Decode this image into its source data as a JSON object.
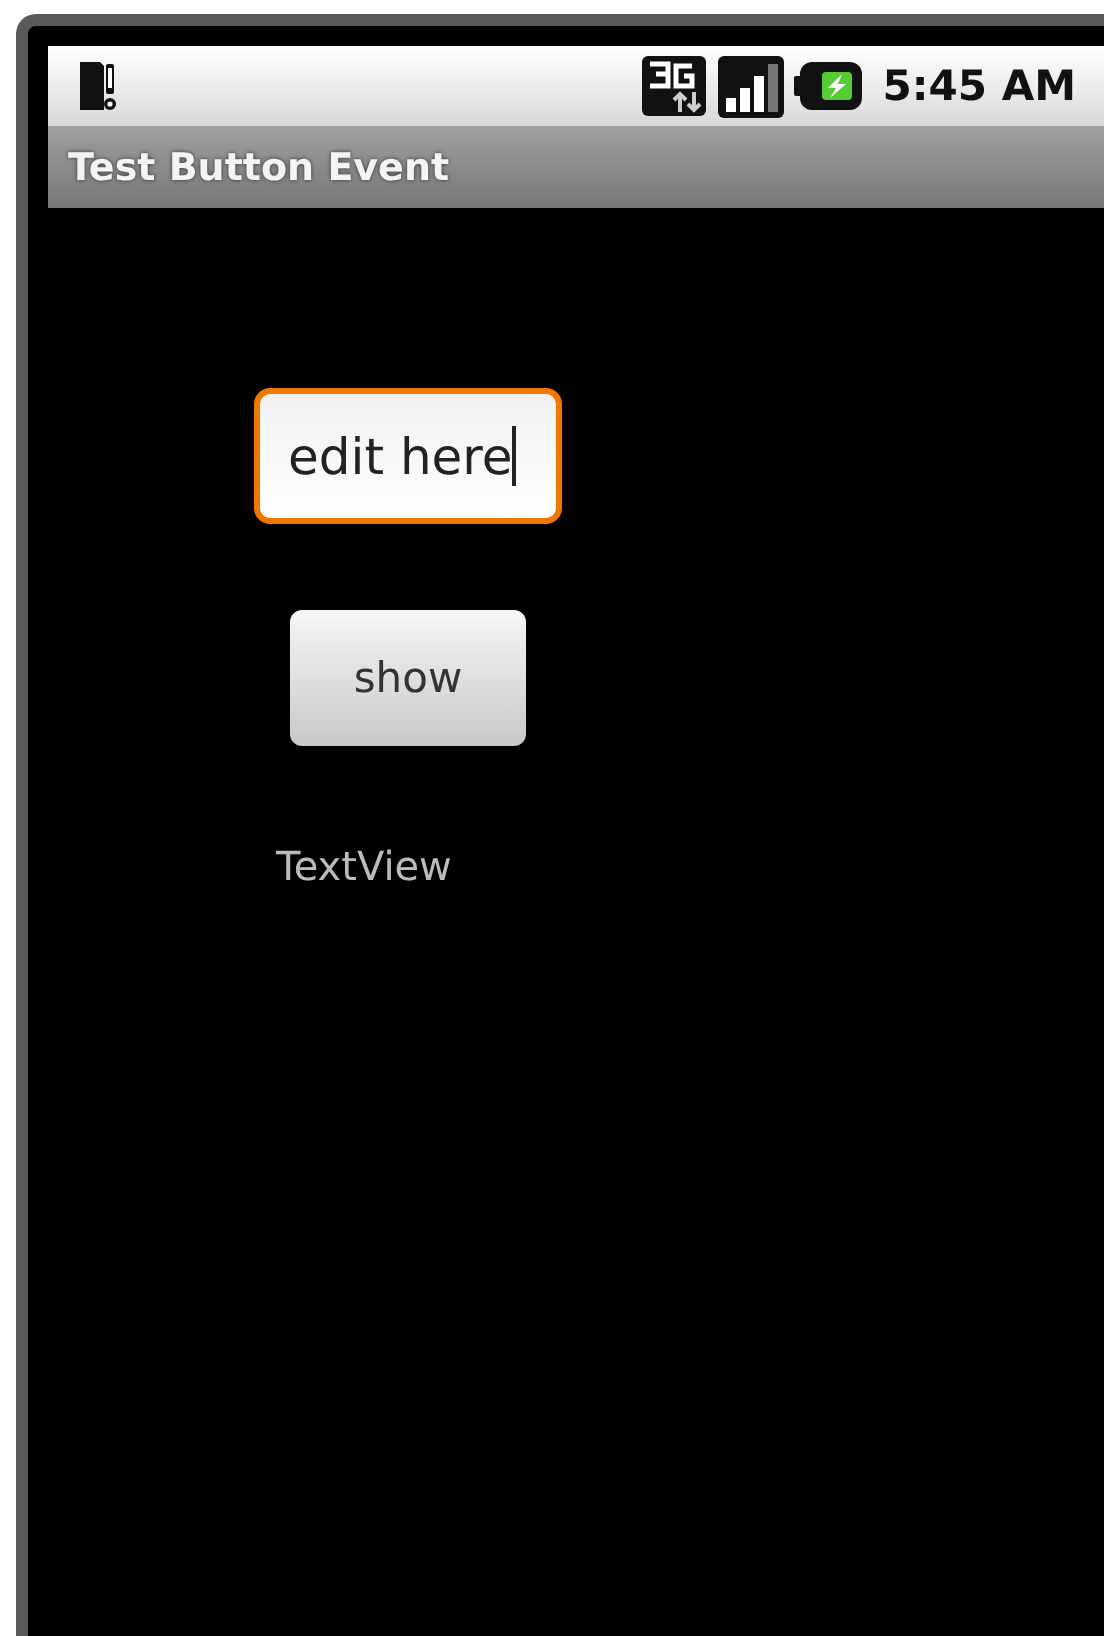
{
  "status_bar": {
    "time": "5:45 AM"
  },
  "title_bar": {
    "title": "Test Button Event"
  },
  "edit_field": {
    "value": "edit here",
    "focused": true
  },
  "button": {
    "label": "show"
  },
  "text_view": {
    "text": "TextView"
  }
}
